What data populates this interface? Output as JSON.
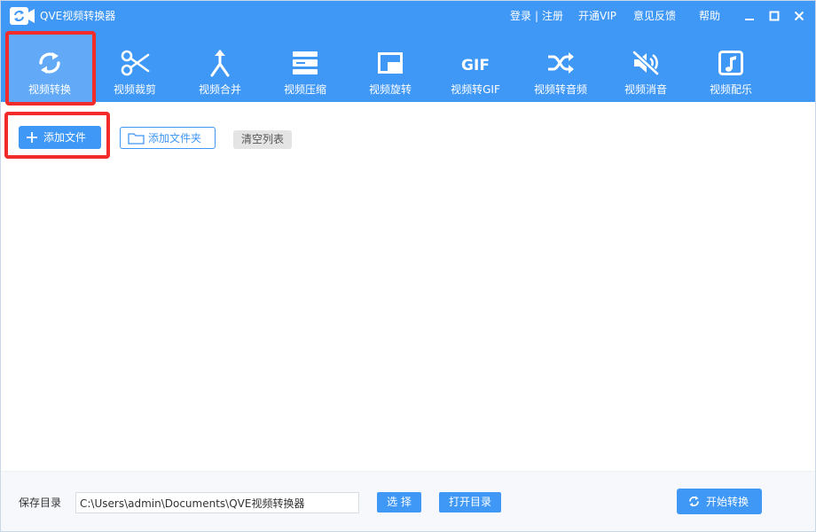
{
  "window": {
    "title": "QVE视频转换器",
    "login": "登录",
    "separator": "|",
    "register": "注册",
    "vip": "开通VIP",
    "feedback": "意见反馈",
    "help": "帮助"
  },
  "toolbar": {
    "items": [
      {
        "label": "视频转换",
        "icon": "convert-icon",
        "active": true
      },
      {
        "label": "视频裁剪",
        "icon": "scissors-icon"
      },
      {
        "label": "视频合并",
        "icon": "merge-icon"
      },
      {
        "label": "视频压缩",
        "icon": "compress-icon"
      },
      {
        "label": "视频旋转",
        "icon": "rotate-icon"
      },
      {
        "label": "视频转GIF",
        "icon": "gif-icon",
        "icon_text": "GIF"
      },
      {
        "label": "视频转音频",
        "icon": "shuffle-icon"
      },
      {
        "label": "视频消音",
        "icon": "mute-icon"
      },
      {
        "label": "视频配乐",
        "icon": "music-icon"
      }
    ]
  },
  "actions": {
    "add_file": "添加文件",
    "add_folder": "添加文件夹",
    "clear_list": "清空列表"
  },
  "footer": {
    "save_label": "保存目录",
    "save_path": "C:\\Users\\admin\\Documents\\QVE视频转换器",
    "choose": "选 择",
    "open_dir": "打开目录",
    "start": "开始转换"
  },
  "colors": {
    "primary": "#3f97f6",
    "active_tool": "#62aaf8",
    "highlight": "#f22b2b",
    "footer_bg": "#f6f8fb"
  }
}
